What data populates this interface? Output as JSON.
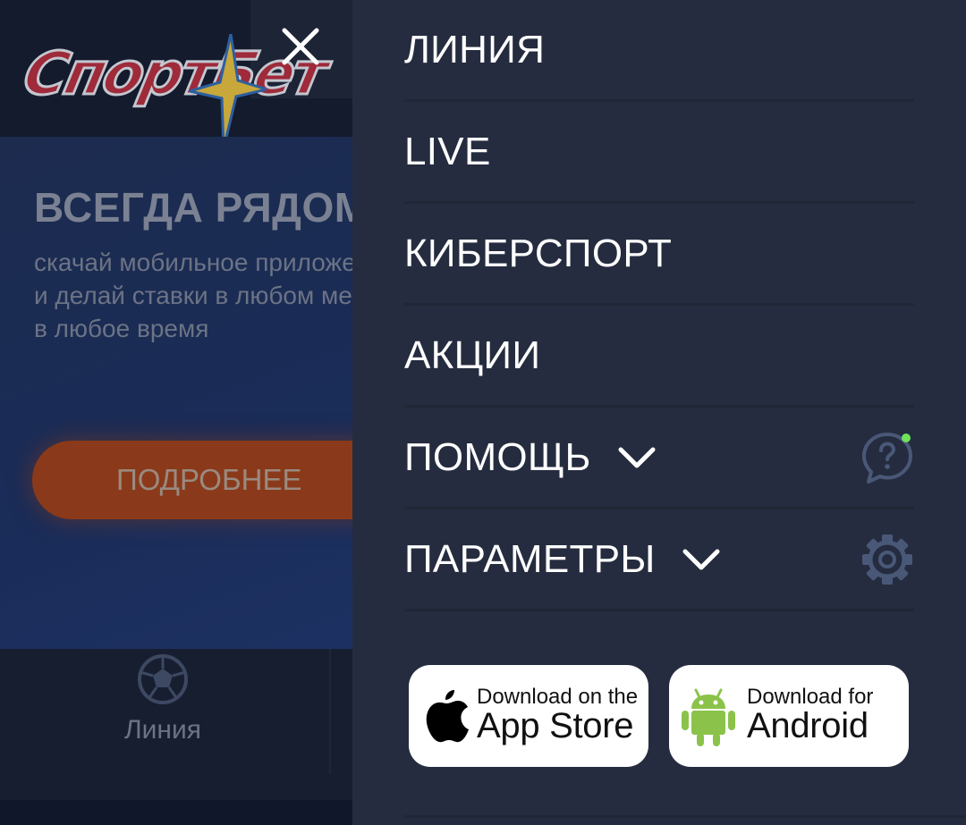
{
  "background": {
    "logo_text": "СпортБет",
    "banner": {
      "title": "ВСЕГДА РЯДОМ",
      "text_lines": [
        "скачай мобильное приложение",
        "и делай ставки в любом месте",
        "в любое время"
      ],
      "button_label": "ПОДРОБНЕЕ"
    },
    "bottom_nav": {
      "tab_label": "Линия"
    }
  },
  "menu": {
    "items": [
      {
        "label": "ЛИНИЯ"
      },
      {
        "label": "LIVE"
      },
      {
        "label": "КИБЕРСПОРТ"
      },
      {
        "label": "АКЦИИ"
      },
      {
        "label": "ПОМОЩЬ",
        "icon": "chat-help-icon"
      },
      {
        "label": "ПАРАМЕТРЫ",
        "icon": "gear-icon"
      }
    ]
  },
  "stores": {
    "apple": {
      "small": "Download on the",
      "big": "App Store"
    },
    "android": {
      "small": "Download for",
      "big": "Android"
    }
  },
  "colors": {
    "drawer_bg": "#252c3f",
    "page_bg": "#131a2d",
    "icon_muted": "#4a5878",
    "online_dot": "#6ee35c",
    "android_green": "#8bc34a",
    "accent_orange": "#8a3a1a"
  }
}
